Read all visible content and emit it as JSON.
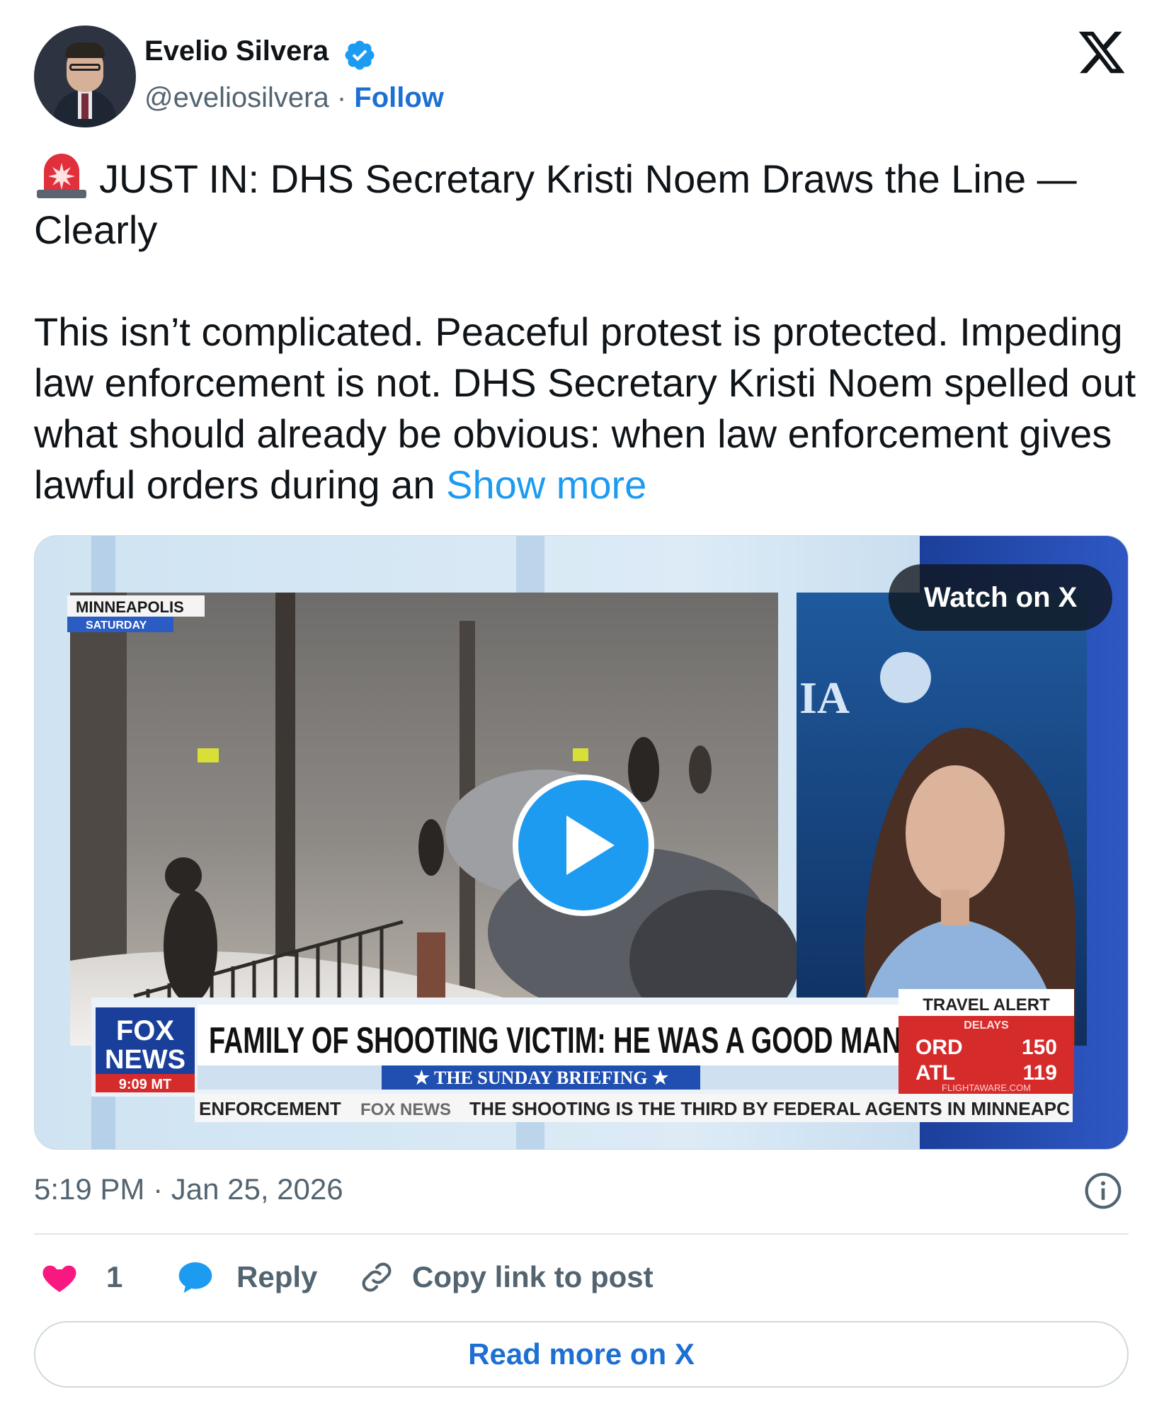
{
  "author": {
    "name": "Evelio Silvera",
    "handle": "@eveliosilvera",
    "separator": "·",
    "follow_label": "Follow"
  },
  "post": {
    "headline": "JUST IN: DHS Secretary Kristi Noem Draws the Line — Clearly",
    "body": "This isn’t complicated. Peaceful protest is protected. Impeding law enforcement is not. DHS Secretary Kristi Noem spelled out what should already be obvious: when law enforcement gives lawful orders during an ",
    "show_more": "Show more"
  },
  "media": {
    "watch_label": "Watch on X",
    "location": "MINNEAPOLIS",
    "day": "SATURDAY",
    "banner_headline": "FAMILY OF SHOOTING VICTIM: HE WAS A GOOD MAN",
    "program": "★ THE SUNDAY BRIEFING ★",
    "network_line1": "FOX",
    "network_line2": "NEWS",
    "clock": "9:09 MT",
    "ticker_left": "ENFORCEMENT",
    "ticker_brand": "FOX NEWS",
    "ticker_right": "THE SHOOTING IS THE THIRD BY FEDERAL AGENTS IN MINNEAPC",
    "travel_title": "TRAVEL ALERT",
    "travel_sub": "DELAYS",
    "travel_rows": [
      {
        "code": "ORD",
        "value": "150"
      },
      {
        "code": "ATL",
        "value": "119"
      }
    ],
    "travel_source": "FLIGHTAWARE.COM",
    "wall_letters": "IA"
  },
  "timestamp": "5:19 PM · Jan 25, 2026",
  "actions": {
    "like_count": "1",
    "reply_label": "Reply",
    "copy_label": "Copy link to post"
  },
  "read_more_label": "Read more on X",
  "colors": {
    "link": "#1d9bf0",
    "follow": "#1c6fd3",
    "like": "#f91880",
    "muted": "#536471"
  }
}
